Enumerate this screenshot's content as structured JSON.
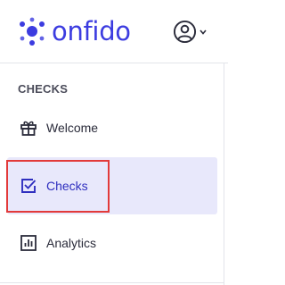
{
  "brand": {
    "name": "onfido",
    "color": "#3c3ce0"
  },
  "header": {
    "user_icon": "user-circle-icon",
    "menu_icon": "chevron-down-icon"
  },
  "sidebar": {
    "section_title": "CHECKS",
    "items": [
      {
        "label": "Welcome",
        "icon": "gift-icon",
        "active": false
      },
      {
        "label": "Checks",
        "icon": "checkbox-icon",
        "active": true
      },
      {
        "label": "Analytics",
        "icon": "bar-chart-icon",
        "active": false
      }
    ]
  },
  "colors": {
    "active_bg": "#e8e8fb",
    "active_text": "#2f2fbf",
    "highlight": "#e23a3a"
  }
}
